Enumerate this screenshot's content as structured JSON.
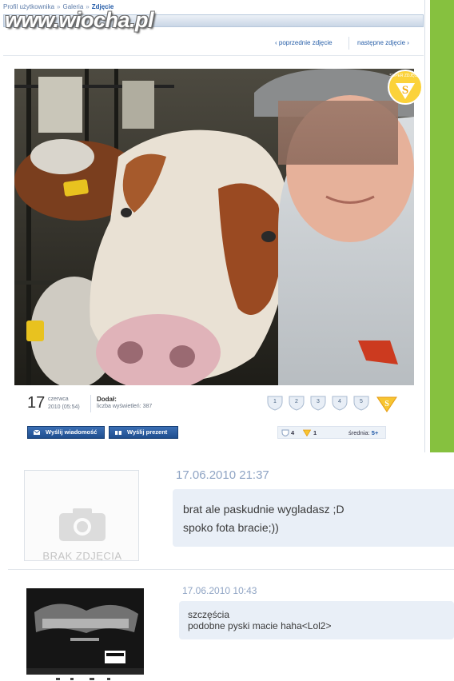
{
  "watermark": "www.wiocha.pl",
  "breadcrumb": {
    "items": [
      "Profil użytkownika",
      "Galeria"
    ],
    "separator": "»",
    "current": "Zdjęcie"
  },
  "tabbar_arrow": "»",
  "navigation": {
    "prev_label": "‹ poprzednie zdjęcie",
    "next_label": "następne zdjęcie ›"
  },
  "photo": {
    "description_icon": "photo-cow-selfie",
    "badge_label": "SUPER ZDJĘCIE"
  },
  "photo_info": {
    "day": "17",
    "month": "czerwca",
    "datetime": "2010 (05:54)",
    "added_by_label": "Dodał:",
    "views_label": "liczba wyświetleń: 387"
  },
  "rating": {
    "options": [
      "1",
      "2",
      "3",
      "4",
      "5"
    ],
    "super_icon": "super-s-icon"
  },
  "buttons": {
    "send_message": "Wyślij wiadomość",
    "send_gift": "Wyślij prezent"
  },
  "stats": {
    "shield_count": "4",
    "super_count": "1",
    "average_label": "średnia:",
    "average_value": "5+"
  },
  "comments": [
    {
      "avatar_text": "BRAK ZDJĘCIA",
      "date": "17.06.2010 21:37",
      "lines": [
        "brat ale paskudnie wygladasz ;D",
        "spoko fota bracie;))"
      ]
    },
    {
      "avatar_icon": "album-cover-avatar",
      "date": "17.06.2010 10:43",
      "lines": [
        "szczęścia",
        "podobne pyski macie haha<Lol2>"
      ]
    }
  ],
  "colors": {
    "accent_blue": "#1f58a6",
    "green_strip": "#86c13f",
    "bubble": "#e9eff7",
    "date_blue": "#8fa4c4"
  }
}
